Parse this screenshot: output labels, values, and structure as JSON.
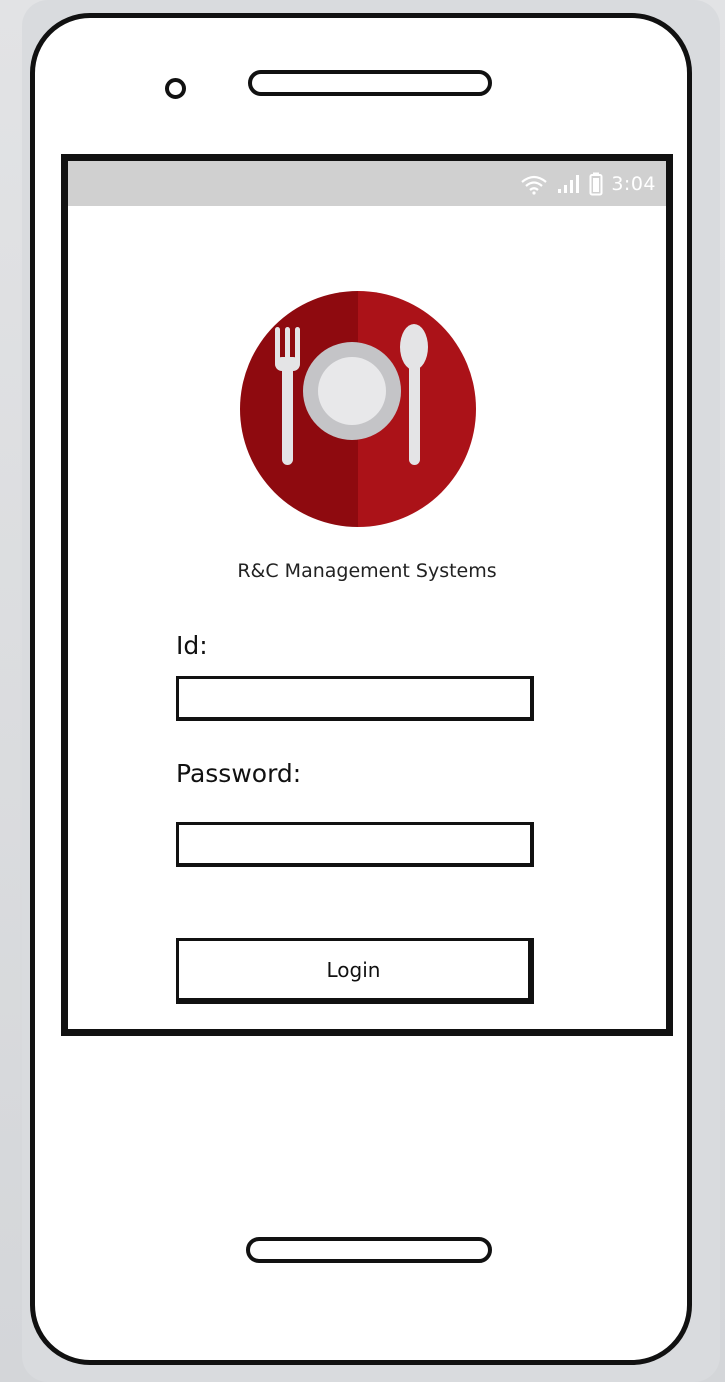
{
  "status_bar": {
    "time": "3:04",
    "icons": [
      "wifi-icon",
      "signal-icon",
      "battery-icon"
    ],
    "background_color": "#d0d0d0"
  },
  "logo": {
    "icon": "restaurant-plate-cutlery-icon",
    "colors": {
      "left_half": "#8e0a0f",
      "right_half": "#ab1218",
      "utensil": "#e4e4e6"
    }
  },
  "app": {
    "title": "R&C Management Systems"
  },
  "form": {
    "id_label": "Id:",
    "id_value": "",
    "password_label": "Password:",
    "password_value": "",
    "login_label": "Login"
  }
}
